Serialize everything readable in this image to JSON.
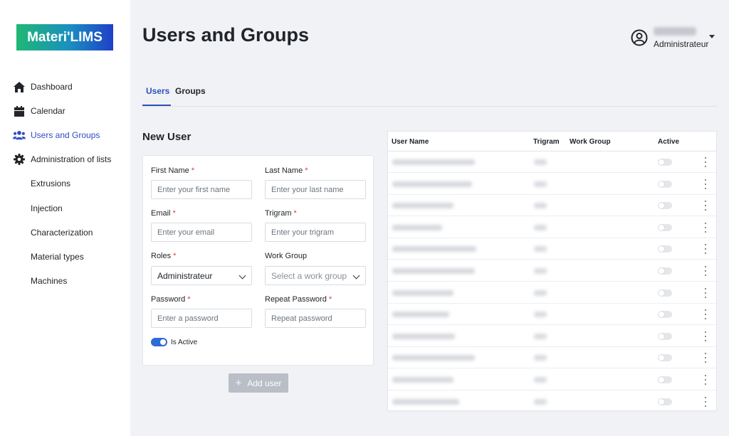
{
  "app": {
    "logo_text": "Materi'LIMS",
    "brand_gradient": [
      "#1fb874",
      "#1a8fc0",
      "#1f3fc9"
    ],
    "accent": "#2d4fc0"
  },
  "sidebar": {
    "items": [
      {
        "label": "Dashboard",
        "icon": "home-icon"
      },
      {
        "label": "Calendar",
        "icon": "calendar-icon"
      },
      {
        "label": "Users and Groups",
        "icon": "users-icon",
        "active": true
      },
      {
        "label": "Administration of lists",
        "icon": "gear-icon"
      },
      {
        "label": "Extrusions"
      },
      {
        "label": "Injection"
      },
      {
        "label": "Characterization"
      },
      {
        "label": "Material types"
      },
      {
        "label": "Machines"
      }
    ]
  },
  "header": {
    "title": "Users and Groups",
    "user_role": "Administrateur"
  },
  "tabs": [
    {
      "label": "Users",
      "active": true
    },
    {
      "label": "Groups"
    }
  ],
  "form": {
    "title": "New User",
    "first_name": {
      "label": "First Name",
      "placeholder": "Enter your first name"
    },
    "last_name": {
      "label": "Last Name",
      "placeholder": "Enter your last name"
    },
    "email": {
      "label": "Email",
      "placeholder": "Enter your email"
    },
    "trigram": {
      "label": "Trigram",
      "placeholder": "Enter your trigram"
    },
    "roles": {
      "label": "Roles",
      "value": "Administrateur"
    },
    "work_group": {
      "label": "Work Group",
      "placeholder": "Select a work group"
    },
    "password": {
      "label": "Password",
      "placeholder": "Enter a password"
    },
    "repeat_password": {
      "label": "Repeat Password",
      "placeholder": "Repeat password"
    },
    "is_active": {
      "label": "Is Active",
      "value": true
    },
    "required_mark": "*",
    "add_button": "Add user"
  },
  "table": {
    "columns": [
      "User Name",
      "Trigram",
      "Work Group",
      "Active"
    ],
    "row_count": 12
  }
}
